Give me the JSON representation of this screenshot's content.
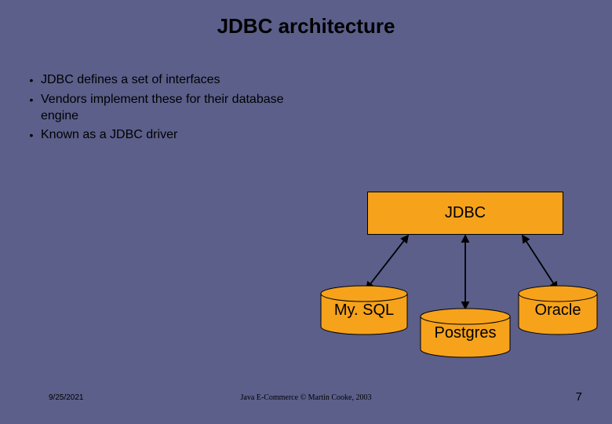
{
  "title": "JDBC architecture",
  "bullets": [
    "JDBC defines a set of interfaces",
    "Vendors implement these for their database engine",
    "Known as a JDBC driver"
  ],
  "diagram": {
    "parent_label": "JDBC",
    "children": [
      "My. SQL",
      "Postgres",
      "Oracle"
    ]
  },
  "footer": {
    "date": "9/25/2021",
    "center": "Java E-Commerce © Martin Cooke, 2003",
    "page": "7"
  },
  "chart_data": {
    "type": "diagram",
    "description": "Hierarchy: JDBC connects via arrows to three database cylinders",
    "root": "JDBC",
    "children": [
      "My. SQL",
      "Postgres",
      "Oracle"
    ]
  }
}
